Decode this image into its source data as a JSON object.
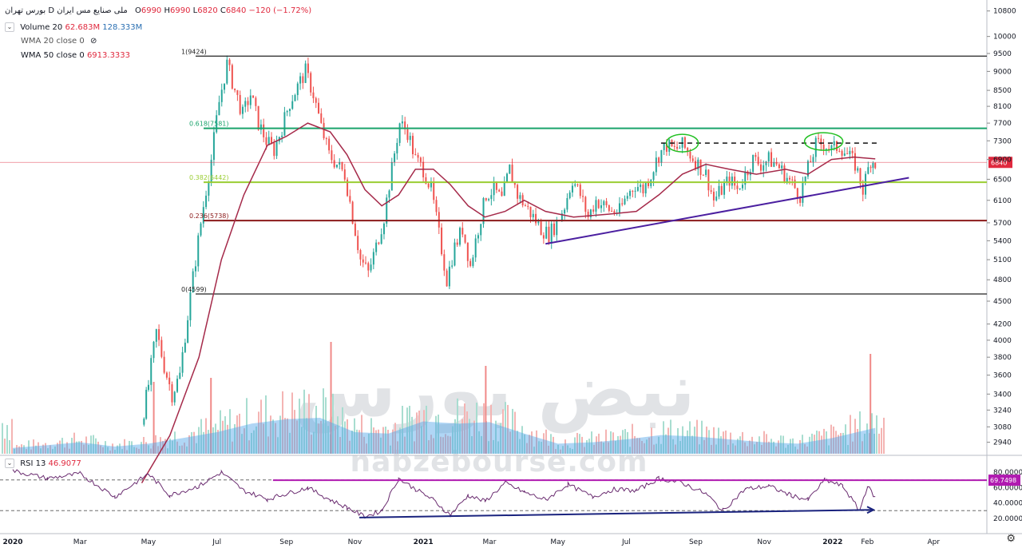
{
  "header": {
    "symbol": "بورس تهران  D  ملی صنایع مس ایران",
    "o_label": "O",
    "o_value": "6990",
    "h_label": "H",
    "h_value": "6990",
    "l_label": "L",
    "l_value": "6820",
    "c_label": "C",
    "c_value": "6840",
    "change": "−120 (−1.72%)"
  },
  "legend": {
    "volume_label": "Volume 20",
    "volume_value1": "62.683M",
    "volume_value2": "128.333M",
    "wma20_label": "WMA 20 close 0",
    "wma50_label": "WMA 50 close 0",
    "wma50_value": "6913.3333",
    "rsi_label": "RSI 13",
    "rsi_value": "46.9077"
  },
  "watermark": {
    "brand": "نبض بورس",
    "url": "nabzebourse.com"
  },
  "colors": {
    "up": "#26a69a",
    "down": "#ef5350",
    "wma": "#a52a4a",
    "fib_618": "#1aa36b",
    "fib_382": "#9acd32",
    "fib_236": "#8b1a1a",
    "fib_edge": "#222222",
    "trendline": "#4b1fa0",
    "rsi_line": "#6a2c70",
    "rsi_level": "#b01ab0",
    "rsi_trend": "#1a237e",
    "highlight_circle": "#22c022",
    "price_tag": "#e0293e"
  },
  "chart_data": {
    "type": "candlestick",
    "price_axis": {
      "ticks": [
        10800,
        10000,
        9500,
        9000,
        8500,
        8100,
        7700,
        7300,
        6900,
        6500,
        6100,
        5700,
        5400,
        5100,
        4800,
        4500,
        4200,
        4000,
        3800,
        3600,
        3400,
        3240,
        3080,
        2940
      ],
      "scale": "log"
    },
    "x_axis": {
      "ticks": [
        "2020",
        "Mar",
        "May",
        "Jul",
        "Sep",
        "Nov",
        "2021",
        "Mar",
        "May",
        "Jul",
        "Sep",
        "Nov",
        "2022",
        "Feb",
        "Apr"
      ],
      "range": [
        "2020-01-01",
        "2022-04-30"
      ]
    },
    "last_price": 6840,
    "fib_levels": [
      {
        "label": "1(9424)",
        "value": 9424
      },
      {
        "label": "0.618(7581)",
        "value": 7581
      },
      {
        "label": "0.382(6442)",
        "value": 6442
      },
      {
        "label": "0.236(5738)",
        "value": 5738
      },
      {
        "label": "0(4599)",
        "value": 4599
      }
    ],
    "resistance_dashed": 7250,
    "trendline": {
      "from": {
        "date": "2021-04-20",
        "price": 5350
      },
      "to": {
        "date": "2022-03-10",
        "price": 6530
      }
    },
    "price_path": [
      [
        "2020-04-25",
        3100
      ],
      [
        "2020-05-01",
        3500
      ],
      [
        "2020-05-08",
        4100
      ],
      [
        "2020-05-15",
        3700
      ],
      [
        "2020-05-22",
        3400
      ],
      [
        "2020-05-29",
        3600
      ],
      [
        "2020-06-05",
        4300
      ],
      [
        "2020-06-12",
        5100
      ],
      [
        "2020-06-19",
        6000
      ],
      [
        "2020-06-26",
        6900
      ],
      [
        "2020-07-03",
        8200
      ],
      [
        "2020-07-10",
        9200
      ],
      [
        "2020-07-17",
        8500
      ],
      [
        "2020-07-24",
        7900
      ],
      [
        "2020-07-31",
        8400
      ],
      [
        "2020-08-07",
        7700
      ],
      [
        "2020-08-14",
        7300
      ],
      [
        "2020-08-21",
        7100
      ],
      [
        "2020-08-28",
        7600
      ],
      [
        "2020-09-04",
        8200
      ],
      [
        "2020-09-11",
        8600
      ],
      [
        "2020-09-18",
        9000
      ],
      [
        "2020-09-25",
        8400
      ],
      [
        "2020-10-02",
        7600
      ],
      [
        "2020-10-09",
        7000
      ],
      [
        "2020-10-16",
        6800
      ],
      [
        "2020-10-23",
        6600
      ],
      [
        "2020-10-30",
        5800
      ],
      [
        "2020-11-06",
        5100
      ],
      [
        "2020-11-13",
        4900
      ],
      [
        "2020-11-20",
        5300
      ],
      [
        "2020-11-27",
        5800
      ],
      [
        "2020-12-04",
        6700
      ],
      [
        "2020-12-11",
        7700
      ],
      [
        "2020-12-18",
        7500
      ],
      [
        "2020-12-25",
        6900
      ],
      [
        "2021-01-01",
        6700
      ],
      [
        "2021-01-08",
        6300
      ],
      [
        "2021-01-15",
        5500
      ],
      [
        "2021-01-22",
        4800
      ],
      [
        "2021-01-29",
        5300
      ],
      [
        "2021-02-05",
        5600
      ],
      [
        "2021-02-12",
        5000
      ],
      [
        "2021-02-19",
        5600
      ],
      [
        "2021-02-26",
        6200
      ],
      [
        "2021-03-05",
        6300
      ],
      [
        "2021-03-12",
        6100
      ],
      [
        "2021-03-19",
        6700
      ],
      [
        "2021-03-26",
        6200
      ],
      [
        "2021-04-02",
        6000
      ],
      [
        "2021-04-09",
        5800
      ],
      [
        "2021-04-16",
        5600
      ],
      [
        "2021-04-23",
        5500
      ],
      [
        "2021-04-30",
        5700
      ],
      [
        "2021-05-07",
        6000
      ],
      [
        "2021-05-14",
        6500
      ],
      [
        "2021-05-21",
        6200
      ],
      [
        "2021-05-28",
        5800
      ],
      [
        "2021-06-04",
        6100
      ],
      [
        "2021-06-11",
        6000
      ],
      [
        "2021-06-18",
        5900
      ],
      [
        "2021-06-25",
        5900
      ],
      [
        "2021-07-02",
        6200
      ],
      [
        "2021-07-09",
        6400
      ],
      [
        "2021-07-16",
        6300
      ],
      [
        "2021-07-23",
        6600
      ],
      [
        "2021-07-30",
        7000
      ],
      [
        "2021-08-06",
        7200
      ],
      [
        "2021-08-13",
        7100
      ],
      [
        "2021-08-20",
        7200
      ],
      [
        "2021-08-27",
        7000
      ],
      [
        "2021-09-03",
        6800
      ],
      [
        "2021-09-10",
        6600
      ],
      [
        "2021-09-17",
        6100
      ],
      [
        "2021-09-24",
        6300
      ],
      [
        "2021-10-01",
        6500
      ],
      [
        "2021-10-08",
        6300
      ],
      [
        "2021-10-15",
        6600
      ],
      [
        "2021-10-22",
        6900
      ],
      [
        "2021-10-29",
        6800
      ],
      [
        "2021-11-05",
        6900
      ],
      [
        "2021-11-12",
        6800
      ],
      [
        "2021-11-19",
        6600
      ],
      [
        "2021-11-26",
        6400
      ],
      [
        "2021-12-03",
        6200
      ],
      [
        "2021-12-10",
        6700
      ],
      [
        "2021-12-17",
        7200
      ],
      [
        "2021-12-24",
        7250
      ],
      [
        "2021-12-31",
        7100
      ],
      [
        "2022-01-07",
        7200
      ],
      [
        "2022-01-14",
        7000
      ],
      [
        "2022-01-21",
        6800
      ],
      [
        "2022-01-28",
        6300
      ],
      [
        "2022-02-04",
        6900
      ],
      [
        "2022-02-08",
        6840
      ]
    ],
    "wma_path": [
      [
        "2020-04-25",
        2600
      ],
      [
        "2020-05-20",
        3000
      ],
      [
        "2020-06-15",
        3800
      ],
      [
        "2020-07-05",
        5100
      ],
      [
        "2020-07-25",
        6200
      ],
      [
        "2020-08-15",
        7200
      ],
      [
        "2020-09-01",
        7400
      ],
      [
        "2020-09-20",
        7700
      ],
      [
        "2020-10-10",
        7500
      ],
      [
        "2020-10-25",
        7000
      ],
      [
        "2020-11-10",
        6300
      ],
      [
        "2020-11-25",
        6000
      ],
      [
        "2020-12-10",
        6200
      ],
      [
        "2020-12-25",
        6700
      ],
      [
        "2021-01-10",
        6700
      ],
      [
        "2021-01-25",
        6400
      ],
      [
        "2021-02-10",
        6000
      ],
      [
        "2021-02-25",
        5800
      ],
      [
        "2021-03-15",
        5900
      ],
      [
        "2021-04-01",
        6100
      ],
      [
        "2021-04-20",
        5900
      ],
      [
        "2021-05-15",
        5800
      ],
      [
        "2021-06-15",
        5850
      ],
      [
        "2021-07-10",
        5900
      ],
      [
        "2021-07-30",
        6200
      ],
      [
        "2021-08-20",
        6600
      ],
      [
        "2021-09-10",
        6800
      ],
      [
        "2021-10-01",
        6700
      ],
      [
        "2021-10-25",
        6600
      ],
      [
        "2021-11-20",
        6700
      ],
      [
        "2021-12-10",
        6600
      ],
      [
        "2021-12-31",
        6900
      ],
      [
        "2022-01-20",
        6950
      ],
      [
        "2022-02-08",
        6913
      ]
    ],
    "volume": {
      "ma_path": [
        [
          "2020-01-01",
          8
        ],
        [
          "2020-02-01",
          12
        ],
        [
          "2020-03-01",
          16
        ],
        [
          "2020-04-01",
          10
        ],
        [
          "2020-05-01",
          14
        ],
        [
          "2020-06-01",
          22
        ],
        [
          "2020-07-01",
          30
        ],
        [
          "2020-08-01",
          42
        ],
        [
          "2020-09-01",
          48
        ],
        [
          "2020-10-01",
          50
        ],
        [
          "2020-11-01",
          30
        ],
        [
          "2020-12-01",
          28
        ],
        [
          "2021-01-01",
          45
        ],
        [
          "2021-02-01",
          42
        ],
        [
          "2021-03-01",
          44
        ],
        [
          "2021-04-01",
          28
        ],
        [
          "2021-05-01",
          14
        ],
        [
          "2021-06-01",
          16
        ],
        [
          "2021-07-01",
          20
        ],
        [
          "2021-08-01",
          26
        ],
        [
          "2021-09-01",
          24
        ],
        [
          "2021-10-01",
          20
        ],
        [
          "2021-11-01",
          16
        ],
        [
          "2021-12-01",
          14
        ],
        [
          "2022-01-01",
          22
        ],
        [
          "2022-02-08",
          36
        ]
      ],
      "spikes": [
        [
          "2020-10-10",
          140
        ],
        [
          "2021-02-25",
          110
        ],
        [
          "2022-02-03",
          125
        ],
        [
          "2020-05-05",
          90
        ],
        [
          "2020-06-25",
          95
        ]
      ]
    },
    "rsi": {
      "range": [
        0,
        100
      ],
      "ticks": [
        80,
        60,
        40,
        20
      ],
      "level_upper": 70,
      "level_lower": 30,
      "last": 46.9077,
      "marker": 69.7498,
      "path": [
        [
          "2020-01-01",
          82
        ],
        [
          "2020-02-01",
          72
        ],
        [
          "2020-03-01",
          78
        ],
        [
          "2020-04-01",
          48
        ],
        [
          "2020-05-01",
          78
        ],
        [
          "2020-05-20",
          50
        ],
        [
          "2020-06-15",
          62
        ],
        [
          "2020-07-05",
          80
        ],
        [
          "2020-07-25",
          56
        ],
        [
          "2020-08-15",
          45
        ],
        [
          "2020-09-01",
          52
        ],
        [
          "2020-09-20",
          60
        ],
        [
          "2020-10-10",
          44
        ],
        [
          "2020-10-25",
          34
        ],
        [
          "2020-11-10",
          22
        ],
        [
          "2020-11-25",
          30
        ],
        [
          "2020-12-10",
          72
        ],
        [
          "2020-12-25",
          58
        ],
        [
          "2021-01-10",
          44
        ],
        [
          "2021-01-25",
          24
        ],
        [
          "2021-02-10",
          50
        ],
        [
          "2021-02-25",
          42
        ],
        [
          "2021-03-15",
          66
        ],
        [
          "2021-04-01",
          54
        ],
        [
          "2021-04-20",
          44
        ],
        [
          "2021-05-10",
          64
        ],
        [
          "2021-06-01",
          48
        ],
        [
          "2021-06-20",
          58
        ],
        [
          "2021-07-10",
          56
        ],
        [
          "2021-07-30",
          72
        ],
        [
          "2021-08-20",
          66
        ],
        [
          "2021-09-10",
          52
        ],
        [
          "2021-09-25",
          30
        ],
        [
          "2021-10-15",
          58
        ],
        [
          "2021-11-05",
          62
        ],
        [
          "2021-11-25",
          50
        ],
        [
          "2021-12-10",
          44
        ],
        [
          "2021-12-25",
          70
        ],
        [
          "2022-01-10",
          62
        ],
        [
          "2022-01-25",
          30
        ],
        [
          "2022-02-01",
          62
        ],
        [
          "2022-02-08",
          47
        ]
      ],
      "trend_from": {
        "date": "2020-11-05",
        "value": 21
      },
      "trend_to": {
        "date": "2022-02-05",
        "value": 31
      },
      "level_line": {
        "from": "2020-08-20",
        "value": 69.7
      }
    }
  }
}
